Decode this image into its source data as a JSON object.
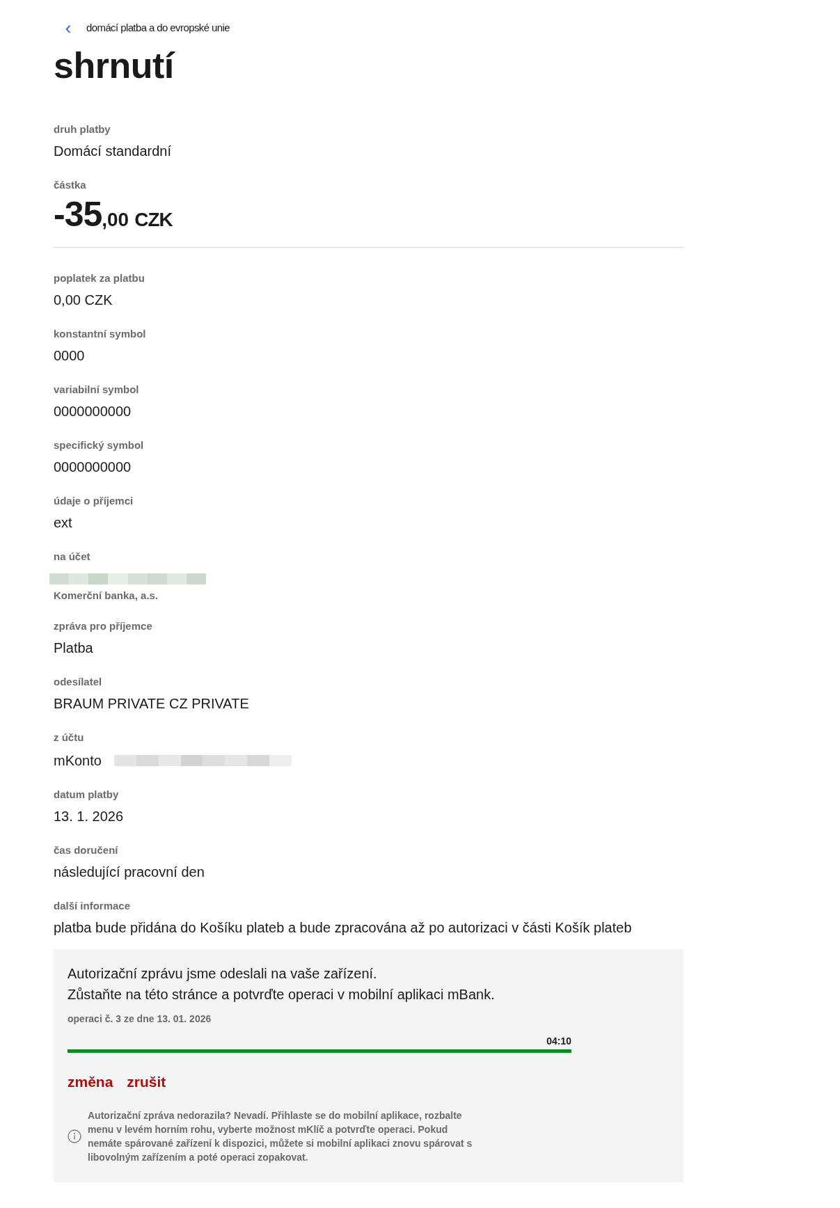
{
  "breadcrumb": {
    "back_icon": "‹",
    "label": "domácí platba a do evropské unie"
  },
  "title": "shrnutí",
  "fields": [
    {
      "kind": "text",
      "label": "druh platby",
      "value": "Domácí standardní"
    },
    {
      "kind": "amount",
      "label": "částka",
      "whole": "-35",
      "decimals": ",00",
      "currency": "CZK"
    },
    {
      "kind": "text",
      "label": "poplatek za platbu",
      "value": "0,00 CZK"
    },
    {
      "kind": "text",
      "label": "konstantní symbol",
      "value": "0000"
    },
    {
      "kind": "text",
      "label": "variabilní symbol",
      "value": "0000000000"
    },
    {
      "kind": "text",
      "label": "specifický symbol",
      "value": "0000000000"
    },
    {
      "kind": "text",
      "label": "údaje o příjemci",
      "value": "ext"
    },
    {
      "kind": "account_to",
      "label": "na účet",
      "bank": "Komerční banka, a.s."
    },
    {
      "kind": "text",
      "label": "zpráva pro příjemce",
      "value": "Platba"
    },
    {
      "kind": "text",
      "label": "odesílatel",
      "value": "BRAUM PRIVATE CZ PRIVATE"
    },
    {
      "kind": "account_from",
      "label": "z účtu",
      "value": "mKonto"
    },
    {
      "kind": "text",
      "label": "datum platby",
      "value": "13. 1. 2026"
    },
    {
      "kind": "text",
      "label": "čas doručení",
      "value": "následující pracovní den"
    },
    {
      "kind": "text",
      "label": "další informace",
      "value": "platba bude přidána do Košíku plateb a bude zpracována až po autorizaci v části Košík plateb"
    }
  ],
  "authorization": {
    "lines": [
      "Autorizační zprávu jsme odeslali na vaše zařízení.",
      "Zůstaňte na této stránce a potvrďte operaci v mobilní aplikaci mBank."
    ],
    "operation": "operaci č. 3 ze dne 13. 01. 2026",
    "timer": "04:10",
    "level": 1,
    "links": [
      "změna",
      "zrušit"
    ],
    "info": "Autorizační zpráva nedorazila? Nevadí. Přihlaste se do mobilní aplikace, rozbalte menu v levém horním rohu, vyberte možnost mKlíč a potvrďte operaci. Pokud nemáte spárované zařízení k dispozici, můžete si mobilní aplikaci znovu spárovat s libovolným zařízením a poté operaci zopakovat."
  }
}
